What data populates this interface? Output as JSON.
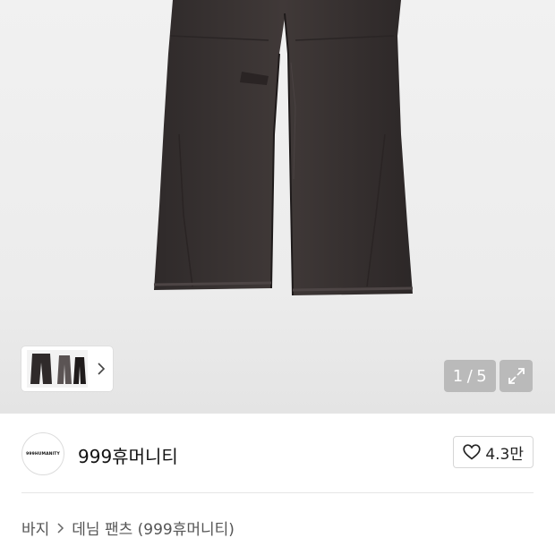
{
  "gallery": {
    "counter_current": "1",
    "counter_separator": "/",
    "counter_total": "5",
    "image_alt": "dark grey denim wide pants"
  },
  "seller": {
    "logo_text": "999HUMANITY",
    "name": "999휴머니티"
  },
  "like": {
    "icon": "heart-outline-icon",
    "count": "4.3만"
  },
  "breadcrumb": {
    "category": "바지",
    "product": "데님 팬츠 (999휴머니티)"
  },
  "colors": {
    "denim": "#3a3434",
    "background": "#ececec"
  }
}
